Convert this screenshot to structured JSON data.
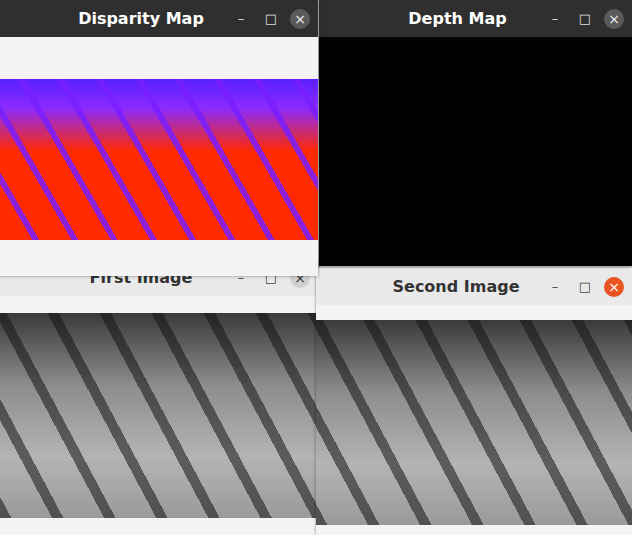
{
  "windows": [
    {
      "title": "First Image",
      "kind": "photo",
      "dark_titlebar": false,
      "focused": false,
      "buttons": [
        "–",
        "□",
        "×"
      ]
    },
    {
      "title": "Second Image",
      "kind": "photo",
      "dark_titlebar": false,
      "focused": true,
      "buttons": [
        "–",
        "□",
        "×"
      ]
    },
    {
      "title": "Depth Map",
      "kind": "depth",
      "dark_titlebar": true,
      "focused": false,
      "buttons": [
        "–",
        "□",
        "×"
      ]
    },
    {
      "title": "Disparity Map",
      "kind": "disparity",
      "dark_titlebar": true,
      "focused": false,
      "buttons": [
        "–",
        "□",
        "×"
      ]
    }
  ]
}
